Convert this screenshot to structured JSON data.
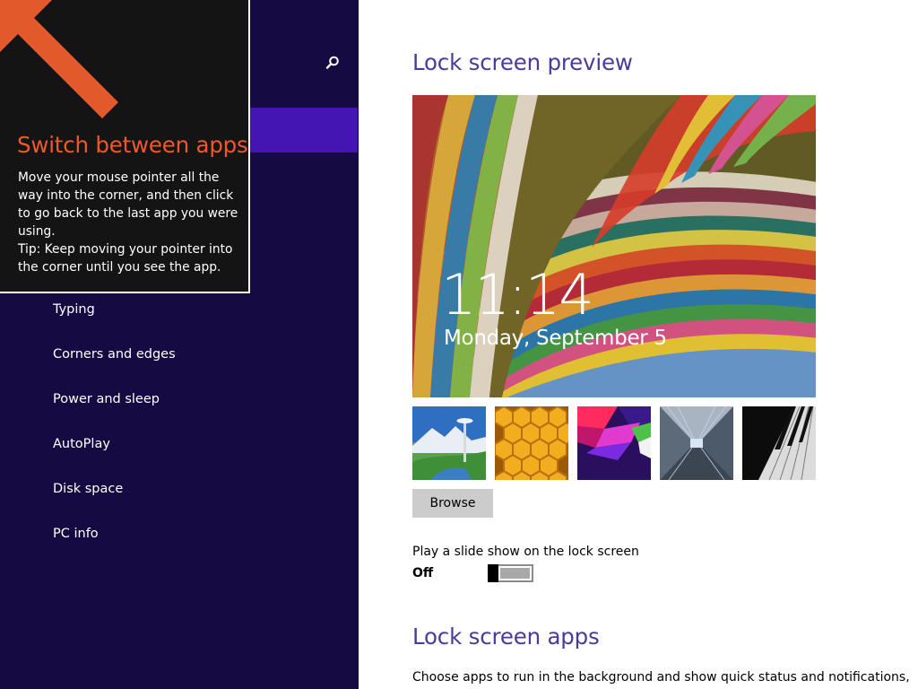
{
  "nav": {
    "search_icon": "search-icon",
    "items": [
      {
        "label": "Typing"
      },
      {
        "label": "Corners and edges"
      },
      {
        "label": "Power and sleep"
      },
      {
        "label": "AutoPlay"
      },
      {
        "label": "Disk space"
      },
      {
        "label": "PC info"
      }
    ]
  },
  "tip": {
    "title": "Switch between apps",
    "body_lines": [
      "Move your mouse pointer all the way into the corner, and then click to go back to the last app you were using.",
      "Tip: Keep moving your pointer into the corner until you see the app."
    ]
  },
  "lock_screen": {
    "preview_heading": "Lock screen preview",
    "time": "11:14",
    "date": "Monday, September 5",
    "thumbnails": [
      {
        "name": "space-needle-thumbnail"
      },
      {
        "name": "honeycomb-thumbnail"
      },
      {
        "name": "color-shapes-thumbnail"
      },
      {
        "name": "tunnel-thumbnail"
      },
      {
        "name": "piano-keys-thumbnail"
      }
    ],
    "browse_label": "Browse",
    "slideshow_label": "Play a slide show on the lock screen",
    "slideshow_state": "Off",
    "apps_heading": "Lock screen apps",
    "apps_description": "Choose apps to run in the background and show quick status and notifications,"
  },
  "colors": {
    "nav_background": "#160a42",
    "nav_selected": "#4515b3",
    "tip_background": "#141414",
    "tip_accent": "#f0582a",
    "heading": "#4b3a99"
  }
}
